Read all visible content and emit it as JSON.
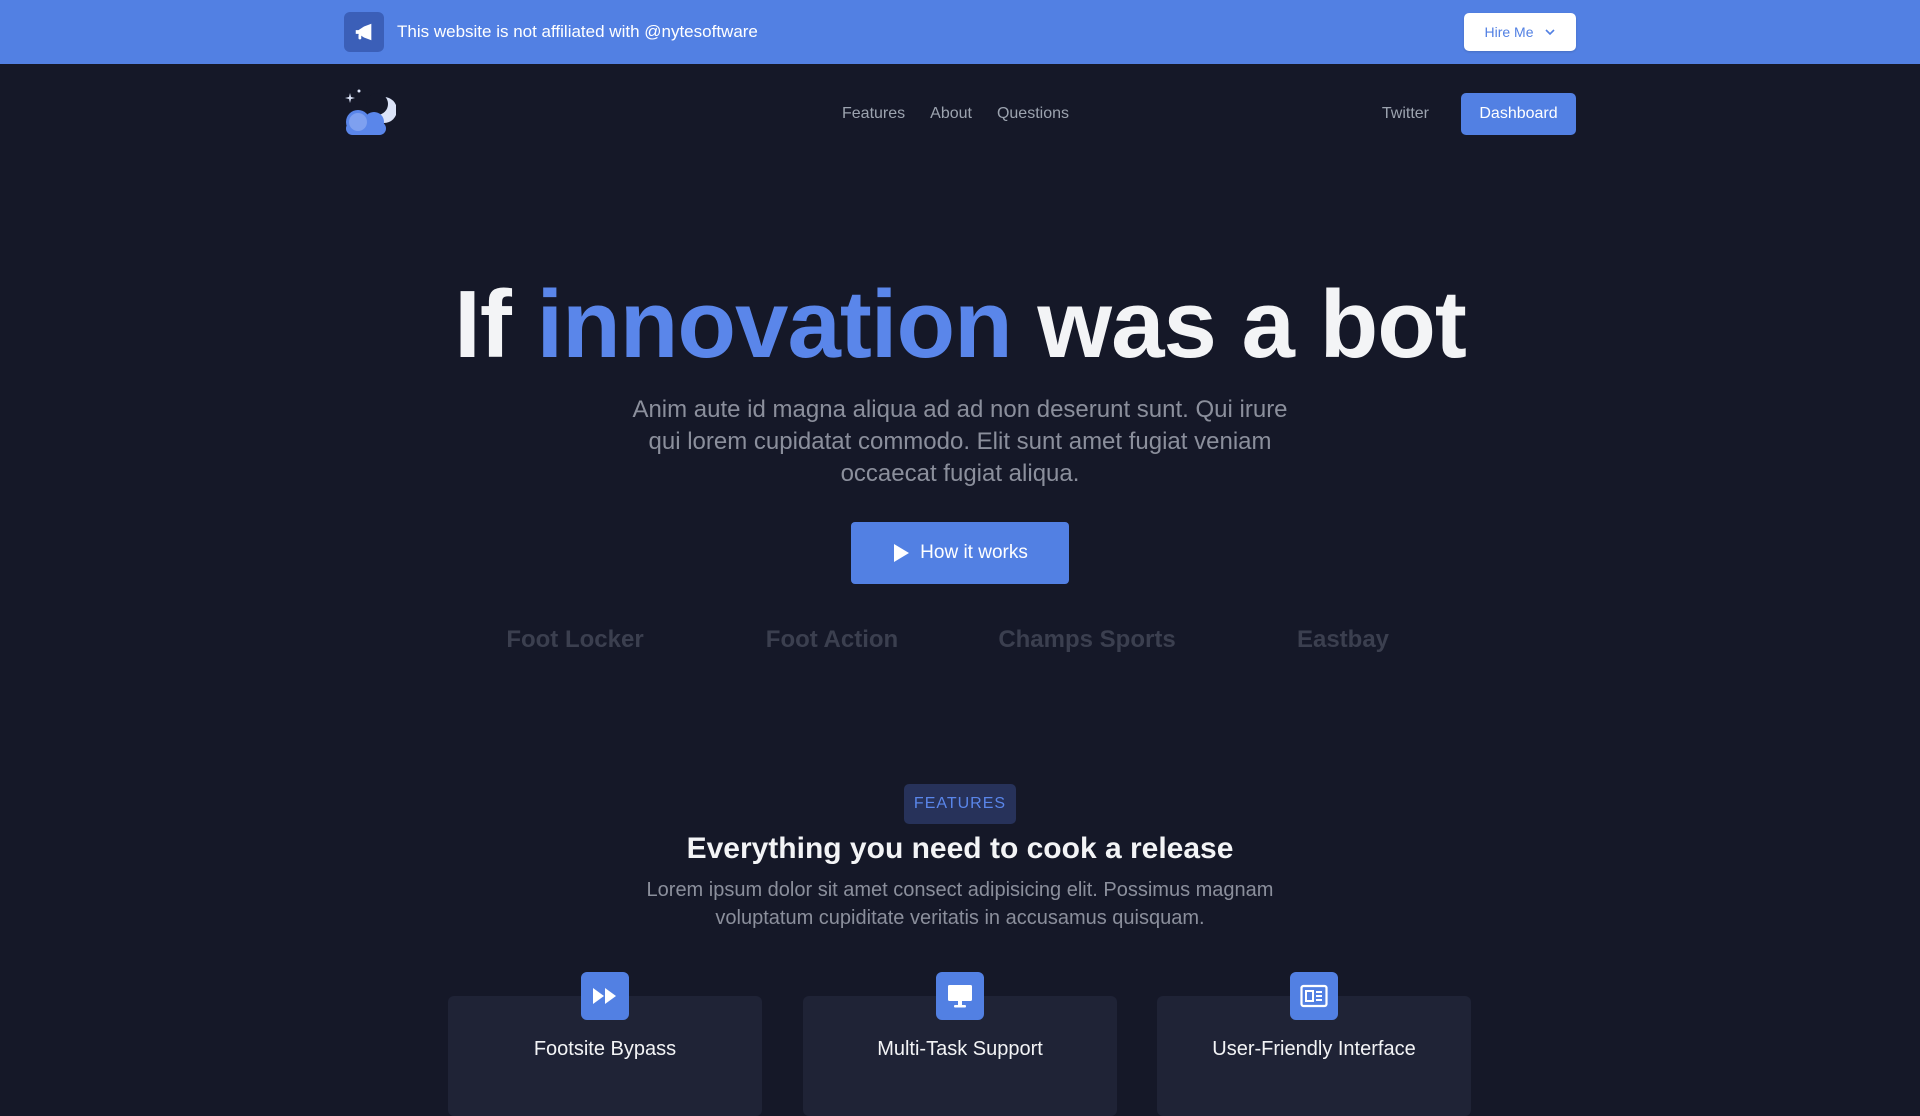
{
  "banner": {
    "icon": "megaphone-icon",
    "text": "This website is not affiliated with @nytesoftware",
    "hire_label": "Hire Me",
    "hire_icon": "chevron-down-icon"
  },
  "nav": {
    "logo_icon": "moon-cloud-logo",
    "links": [
      "Features",
      "About",
      "Questions"
    ],
    "twitter_label": "Twitter",
    "dashboard_label": "Dashboard"
  },
  "hero": {
    "title_pre": "If ",
    "title_accent": "innovation",
    "title_post": " was a bot",
    "subtitle": "Anim aute id magna aliqua ad ad non deserunt sunt. Qui irure qui lorem cupidatat commodo. Elit sunt amet fugiat veniam occaecat fugiat aliqua.",
    "cta_label": "How it works",
    "cta_icon": "play-icon"
  },
  "brands": [
    "Foot Locker",
    "Foot Action",
    "Champs Sports",
    "Eastbay"
  ],
  "features": {
    "badge": "FEATURES",
    "title": "Everything you need to cook a release",
    "subtitle": "Lorem ipsum dolor sit amet consect adipisicing elit. Possimus magnam voluptatum cupiditate veritatis in accusamus quisquam.",
    "cards": [
      {
        "title": "Footsite Bypass",
        "icon": "fast-forward-icon"
      },
      {
        "title": "Multi-Task Support",
        "icon": "monitor-icon"
      },
      {
        "title": "User-Friendly Interface",
        "icon": "newspaper-icon"
      }
    ]
  },
  "colors": {
    "background": "#151828",
    "accent": "#5280e3",
    "accent_text": "#5a86ea",
    "card": "#1f2336"
  }
}
